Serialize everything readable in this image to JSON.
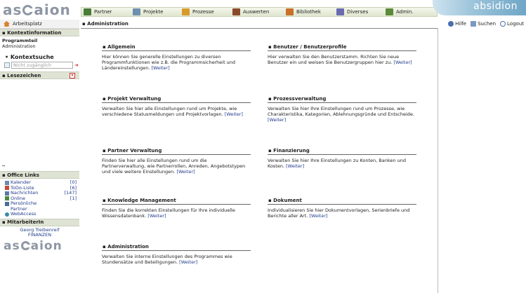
{
  "app": {
    "logo": "ascaion",
    "brand": "absidion"
  },
  "menu": [
    {
      "label": "Partner",
      "icon": "partner-icon",
      "color": "#4a7c3a"
    },
    {
      "label": "Projekte",
      "icon": "projekte-icon",
      "color": "#6f8fb0"
    },
    {
      "label": "Prozesse",
      "icon": "prozesse-icon",
      "color": "#d89a2a"
    },
    {
      "label": "Auswerten",
      "icon": "auswerten-icon",
      "color": "#8a4a2a"
    },
    {
      "label": "Bibliothek",
      "icon": "bibliothek-icon",
      "color": "#c9702a"
    },
    {
      "label": "Diverses",
      "icon": "diverses-icon",
      "color": "#6a6ab0"
    },
    {
      "label": "Admin.",
      "icon": "admin-icon",
      "color": "#5a8a3a"
    }
  ],
  "util": [
    {
      "label": "Hilfe",
      "icon": "help-icon",
      "color": "#4a6fb0"
    },
    {
      "label": "Suchen",
      "icon": "search-icon",
      "color": "#7a9ac0"
    },
    {
      "label": "Logout",
      "icon": "logout-icon",
      "color": "#4a6fb0"
    }
  ],
  "sidebar": {
    "home": "Arbeitsplatz",
    "kontext_head": "▪ Kontextinformation",
    "kontext_label": "Programmteil",
    "kontext_value": "Administration",
    "kontextsuche": "•  Kontextsuche",
    "kontextsuche_value": "Nicht zugänglich",
    "lesezeichen": "▪ Lesezeichen",
    "office_head": "▪ Office Links",
    "links": [
      {
        "label": "Kalender",
        "count": "[0]",
        "color": "#6a8ab0"
      },
      {
        "label": "ToDo-Liste",
        "count": "[6]",
        "color": "#c94a3a"
      },
      {
        "label": "Nachrichten",
        "count": "[147]",
        "color": "#5a7aa0"
      },
      {
        "label": "Online",
        "count": "[1]",
        "color": "#4a8a3a"
      },
      {
        "label": "Persönliche Partner",
        "count": "",
        "color": "#4a6a9a"
      },
      {
        "label": "WebAccess",
        "count": "",
        "color": "#3a8ab0"
      }
    ],
    "mitarbeiter_head": "▪ MitarbeiterIn",
    "user_name": "Georg Treibenreif",
    "user_org": "FINANZEN"
  },
  "main": {
    "title": "▪ Administration",
    "weiter": "[Weiter]",
    "blocks": [
      {
        "title": "▪ Allgemein",
        "text": "Hier können Sie generelle Einstellungen zu diversen Programmfunktionen wie z.B. die Programmsicherheit und Ländereinstellungen."
      },
      {
        "title": "▪ Benutzer / Benutzerprofile",
        "text": "Hier verwalten Sie den Benutzerstamm. Richten Sie neue Benutzer ein und weisen Sie Benutzergruppen hier zu."
      },
      {
        "title": "▪ Projekt Verwaltung",
        "text": "Verwalten Sie hier alle Einstellungen rund um Projekte, wie verschiedene Statusmeldungen und Projektvorlagen."
      },
      {
        "title": "▪ Prozessverwaltung",
        "text": "Verwalten Sie hier Ihre Einstellungen rund um Prozesse, wie Charakteristika, Kategorien, Ablehnungsgründe und Entscheide."
      },
      {
        "title": "▪ Partner Verwaltung",
        "text": "Finden Sie hier alle Einstellungen rund um die Partnerverwaltung, wie Partnerrollen, Anreden, Angebotstypen und viele weitere Einstellungen."
      },
      {
        "title": "▪ Finanzierung",
        "text": "Verwalten Sie hier Ihre Einstellungen zu Konten, Banken und Kosten."
      },
      {
        "title": "▪ Knowledge Management",
        "text": "Finden Sie die korrekten Einstellungen für Ihre individuelle Wissensdatenbank."
      },
      {
        "title": "▪ Dokument",
        "text": "Individualisieren Sie hier Dokumentvorlagen, Serienbriefe und Berichte aller Art."
      },
      {
        "title": "▪ Administration",
        "text": "Verwalten Sie interne Einstellungen des Programmes wie Stundensätze und Beteiligungen."
      }
    ]
  }
}
